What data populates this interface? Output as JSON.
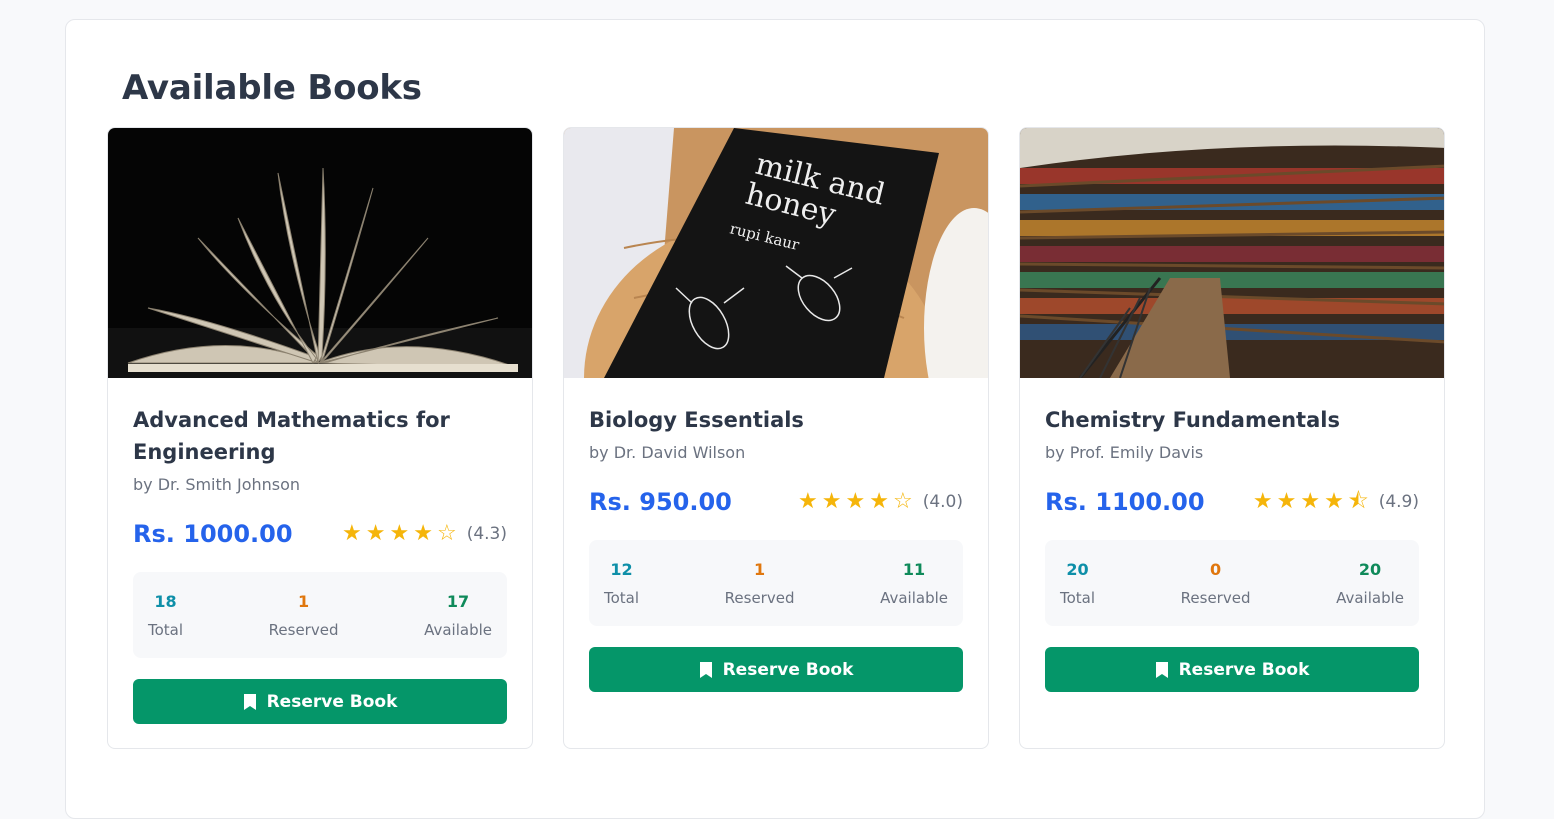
{
  "page": {
    "heading": "Available Books"
  },
  "books": [
    {
      "title": "Advanced Mathematics for Engineering",
      "author": "by Dr. Smith Johnson",
      "price": "Rs. 1000.00",
      "stars": [
        "full",
        "full",
        "full",
        "full",
        "empty"
      ],
      "rating_text": "(4.3)",
      "total": "18",
      "total_label": "Total",
      "reserved": "1",
      "reserved_label": "Reserved",
      "available": "17",
      "available_label": "Available",
      "button_label": "Reserve Book",
      "image": "open-book-dark"
    },
    {
      "title": "Biology Essentials",
      "author": "by Dr. David Wilson",
      "price": "Rs. 950.00",
      "stars": [
        "full",
        "full",
        "full",
        "full",
        "empty"
      ],
      "rating_text": "(4.0)",
      "total": "12",
      "total_label": "Total",
      "reserved": "1",
      "reserved_label": "Reserved",
      "available": "11",
      "available_label": "Available",
      "button_label": "Reserve Book",
      "image": "milk-and-honey-book",
      "cover_text": [
        "milk and",
        "honey",
        "rupi kaur"
      ]
    },
    {
      "title": "Chemistry Fundamentals",
      "author": "by Prof. Emily Davis",
      "price": "Rs. 1100.00",
      "stars": [
        "full",
        "full",
        "full",
        "full",
        "half"
      ],
      "rating_text": "(4.9)",
      "total": "20",
      "total_label": "Total",
      "reserved": "0",
      "reserved_label": "Reserved",
      "available": "20",
      "available_label": "Available",
      "button_label": "Reserve Book",
      "image": "library-shelves"
    }
  ],
  "colors": {
    "price": "#2563eb",
    "button": "#059669",
    "star": "#f5b50a",
    "total": "#0e8fa8",
    "reserved": "#e0770e",
    "available": "#0f8a5a"
  }
}
